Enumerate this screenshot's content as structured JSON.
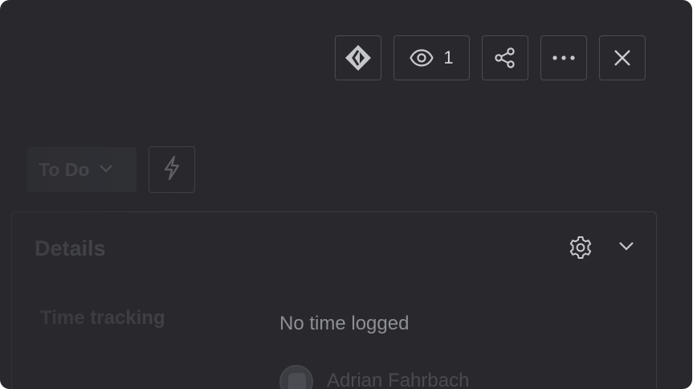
{
  "toolbar": {
    "dev_label": "",
    "watchers_count": "1",
    "share_label": "",
    "more_label": "",
    "close_label": ""
  },
  "status": {
    "label": "To Do"
  },
  "details": {
    "title": "Details",
    "fields": [
      {
        "label": "Time tracking",
        "value": "No time logged"
      }
    ],
    "assignee": {
      "name": "Adrian Fahrbach"
    }
  },
  "colors": {
    "background": "#29292d",
    "border": "#4a4b52",
    "text_primary": "#d6d7dc",
    "text_muted": "#8e8f96"
  }
}
